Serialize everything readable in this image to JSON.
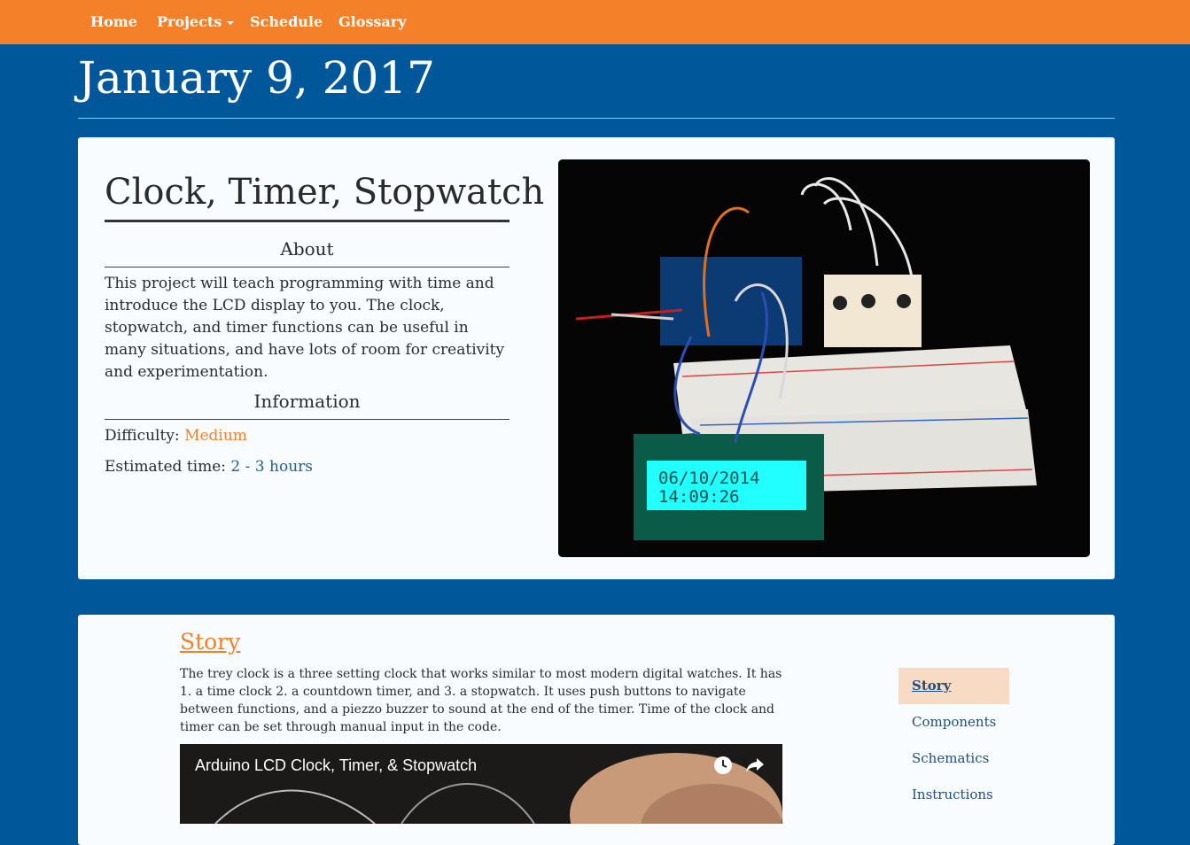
{
  "navbar": {
    "items": [
      {
        "label": "Home"
      },
      {
        "label": "Projects",
        "dropdown": true
      },
      {
        "label": "Schedule"
      },
      {
        "label": "Glossary"
      }
    ]
  },
  "page": {
    "date": "January 9, 2017"
  },
  "project": {
    "title": "Clock, Timer, Stopwatch",
    "about_heading": "About",
    "about_text": "This project will teach programming with time and introduce the LCD display to you. The clock, stopwatch, and timer functions can be useful in many situations, and have lots of room for creativity and experimentation.",
    "information_heading": "Information",
    "difficulty_label": "Difficulty:",
    "difficulty_value": "Medium",
    "time_label": "Estimated time:",
    "time_value": "2 - 3 hours",
    "photo": {
      "lcd_line1": "06/10/2014",
      "lcd_line2": "14:09:26"
    }
  },
  "story": {
    "heading": "Story",
    "text": "The trey clock is a three setting clock that works similar to most modern digital watches. It has 1. a time clock 2. a countdown timer, and 3. a stopwatch. It uses push buttons to navigate between functions, and a piezzo buzzer to sound at the end of the timer. Time of the clock and timer can be set through manual input in the code.",
    "video_title": "Arduino LCD Clock, Timer, & Stopwatch"
  },
  "side_nav": {
    "items": [
      {
        "label": "Story",
        "active": true
      },
      {
        "label": "Components"
      },
      {
        "label": "Schematics"
      },
      {
        "label": "Instructions"
      }
    ]
  },
  "colors": {
    "navbar": "#f4812a",
    "background": "#00579a",
    "accent_orange": "#f4812a",
    "accent_blue": "#1f5f98",
    "active_nav_bg": "#f8dbc4"
  }
}
